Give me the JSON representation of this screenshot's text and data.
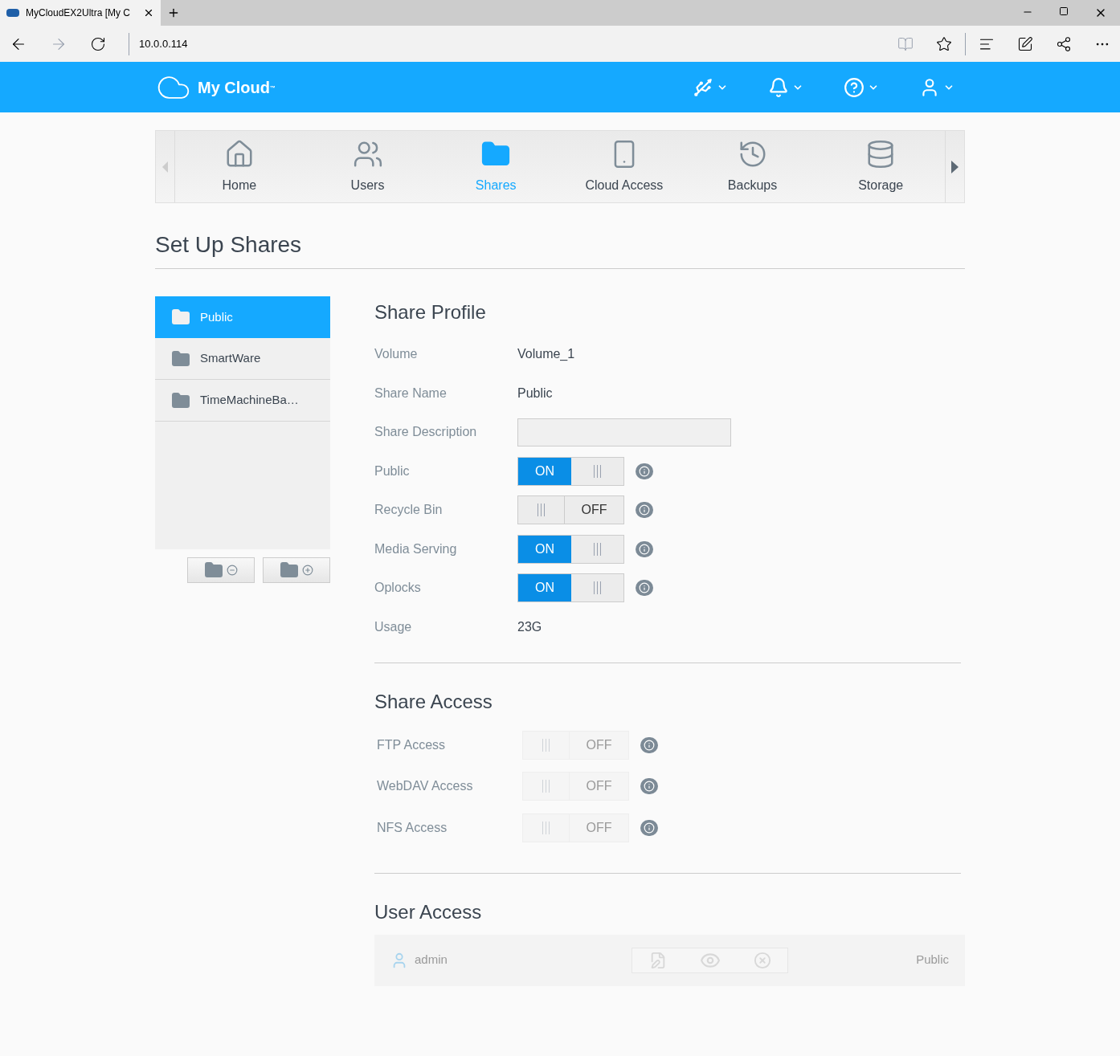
{
  "browser": {
    "tab_title": "MyCloudEX2Ultra [My C",
    "url": "10.0.0.114"
  },
  "header": {
    "logo_text": "My Cloud",
    "trademark": "™"
  },
  "nav": [
    {
      "label": "Home",
      "selected": false
    },
    {
      "label": "Users",
      "selected": false
    },
    {
      "label": "Shares",
      "selected": true
    },
    {
      "label": "Cloud Access",
      "selected": false
    },
    {
      "label": "Backups",
      "selected": false
    },
    {
      "label": "Storage",
      "selected": false
    }
  ],
  "page_title": "Set Up Shares",
  "shares": [
    {
      "name": "Public",
      "selected": true
    },
    {
      "name": "SmartWare",
      "selected": false
    },
    {
      "name": "TimeMachineBa…",
      "selected": false
    }
  ],
  "profile": {
    "title": "Share Profile",
    "fields": [
      {
        "kind": "text",
        "label": "Volume",
        "value": "Volume_1"
      },
      {
        "kind": "text",
        "label": "Share Name",
        "value": "Public"
      },
      {
        "kind": "input",
        "label": "Share Description"
      },
      {
        "kind": "toggle",
        "label": "Public",
        "on": true,
        "state_text": "ON"
      },
      {
        "kind": "toggle",
        "label": "Recycle Bin",
        "on": false,
        "state_text": "OFF"
      },
      {
        "kind": "toggle",
        "label": "Media Serving",
        "on": true,
        "state_text": "ON"
      },
      {
        "kind": "toggle",
        "label": "Oplocks",
        "on": true,
        "state_text": "ON"
      },
      {
        "kind": "text",
        "label": "Usage",
        "value": "23G"
      }
    ]
  },
  "access": {
    "title": "Share Access",
    "items": [
      {
        "label": "FTP Access",
        "on": false,
        "disabled": true,
        "state_text": "OFF"
      },
      {
        "label": "WebDAV Access",
        "on": false,
        "disabled": true,
        "state_text": "OFF"
      },
      {
        "label": "NFS Access",
        "on": false,
        "disabled": true,
        "state_text": "OFF"
      }
    ]
  },
  "user_access": {
    "title": "User Access",
    "rows": [
      {
        "user": "admin",
        "permission": "Public"
      }
    ]
  }
}
